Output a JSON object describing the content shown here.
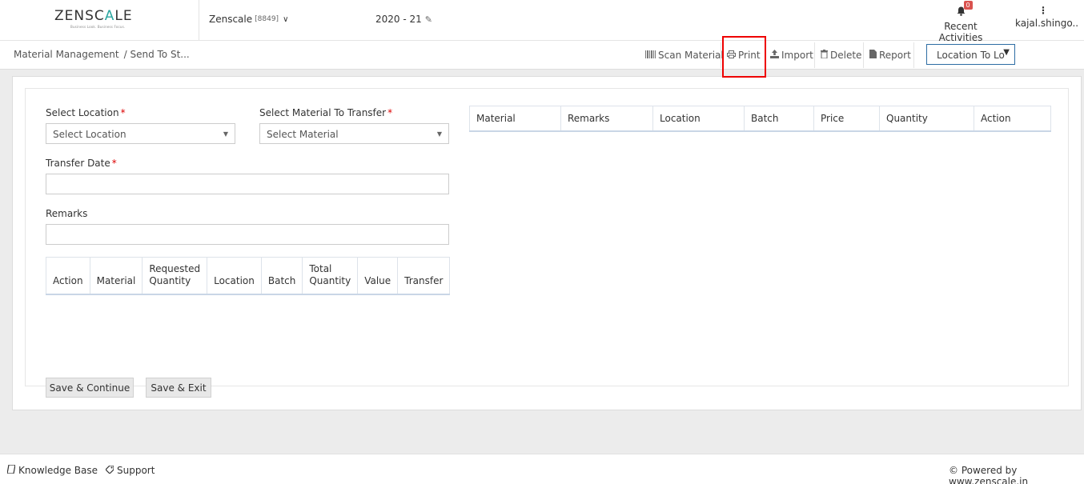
{
  "header": {
    "logo": {
      "part1": "ZENSC",
      "accent": "A",
      "part2": "LE",
      "tagline": "Business Look. Business Focus."
    },
    "company": {
      "name": "Zenscale",
      "code": "[8849]"
    },
    "year": "2020 - 21",
    "notifications": {
      "count": "0",
      "label": "Recent Activities"
    },
    "user": {
      "name": "kajal.shingo.."
    }
  },
  "toolbar": {
    "breadcrumb": {
      "root": "Material Management",
      "current": "/ Send To St..."
    },
    "scan_label": "Scan Material",
    "print_label": "Print",
    "import_label": "Import",
    "delete_label": "Delete",
    "report_label": "Report",
    "location_mode": "Location To Lo"
  },
  "form": {
    "location_label": "Select Location",
    "location_value": "Select Location",
    "material_label": "Select Material To Transfer",
    "material_value": "Select Material",
    "date_label": "Transfer Date",
    "remarks_label": "Remarks",
    "required_mark": "*"
  },
  "transfer_table": {
    "headers": [
      "Action",
      "Material",
      "Requested Quantity",
      "Location",
      "Batch",
      "Total Quantity",
      "Value",
      "Transfer"
    ]
  },
  "material_table": {
    "headers": [
      "Material",
      "Remarks",
      "Location",
      "Batch",
      "Price",
      "Quantity",
      "Action"
    ]
  },
  "actions": {
    "save_continue": "Save & Continue",
    "save_exit": "Save & Exit"
  },
  "footer": {
    "knowledge_base": "Knowledge Base",
    "support": "Support",
    "powered_by": "© Powered by www.zenscale.in"
  },
  "colors": {
    "accent": "#2aa6a0",
    "badge": "#d9534f",
    "highlight": "#ee0000",
    "select_border": "#2e6da4"
  }
}
